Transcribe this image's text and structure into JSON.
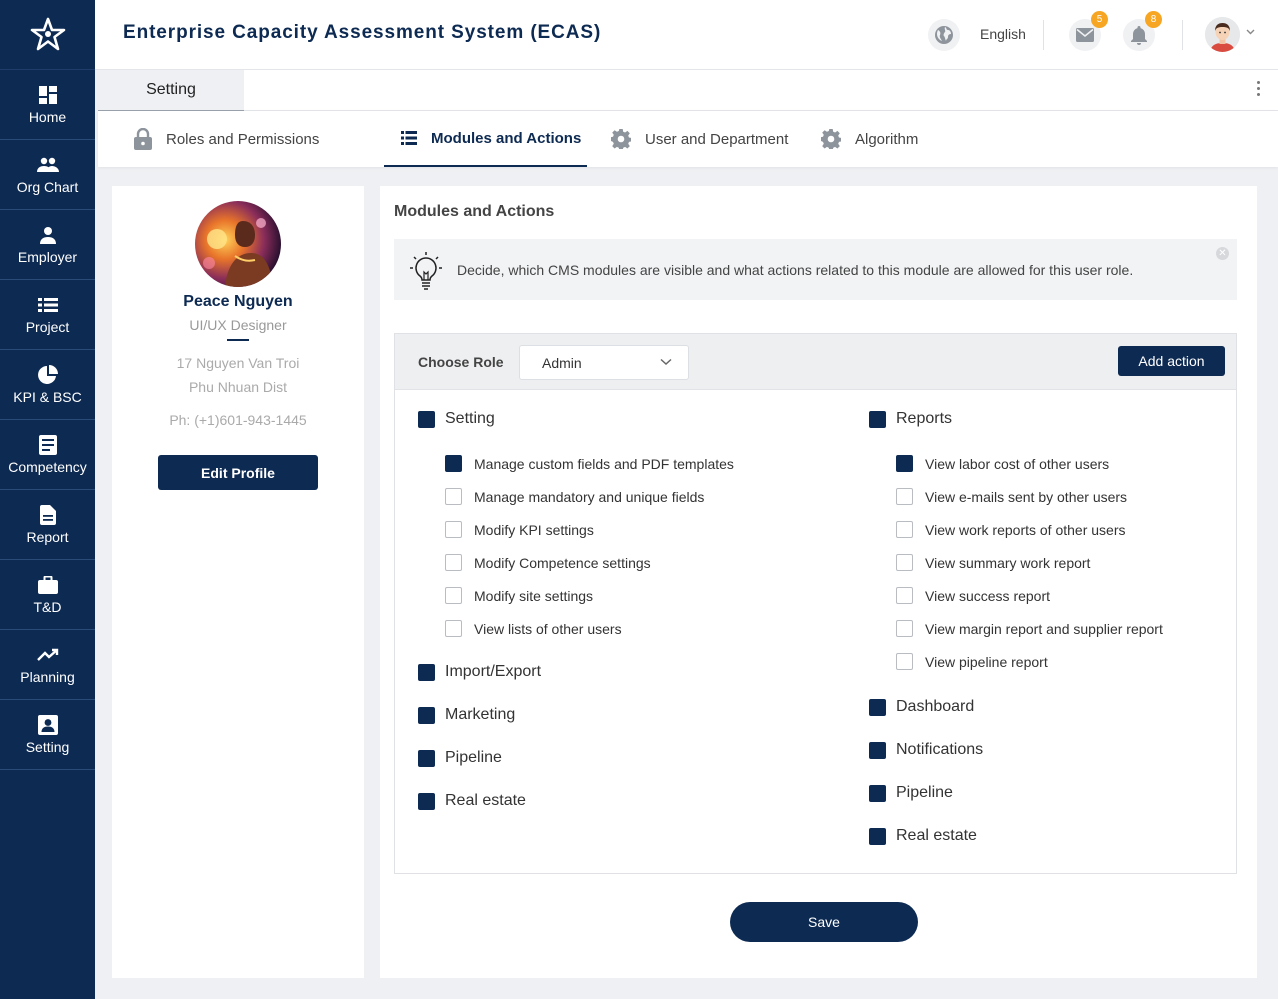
{
  "app": {
    "title": "Enterprise Capacity Assessment System (ECAS)"
  },
  "header": {
    "language": "English",
    "mail_count": "5",
    "notification_count": "8"
  },
  "sidebar": {
    "items": [
      {
        "label": "Home",
        "icon": "dashboard-icon"
      },
      {
        "label": "Org Chart",
        "icon": "people-icon"
      },
      {
        "label": "Employer",
        "icon": "person-icon"
      },
      {
        "label": "Project",
        "icon": "list-icon"
      },
      {
        "label": "KPI & BSC",
        "icon": "pie-chart-icon"
      },
      {
        "label": "Competency",
        "icon": "document-icon"
      },
      {
        "label": "Report",
        "icon": "file-icon"
      },
      {
        "label": "T&D",
        "icon": "briefcase-icon"
      },
      {
        "label": "Planning",
        "icon": "trending-up-icon"
      },
      {
        "label": "Setting",
        "icon": "badge-icon"
      }
    ]
  },
  "page_tab": "Setting",
  "tabs": [
    {
      "label": "Roles and Permissions",
      "icon": "lock-icon"
    },
    {
      "label": "Modules and Actions",
      "icon": "list-icon",
      "active": true
    },
    {
      "label": "User and Department",
      "icon": "gear-icon"
    },
    {
      "label": "Algorithm",
      "icon": "gear-icon"
    }
  ],
  "profile": {
    "name": "Peace Nguyen",
    "role": "UI/UX Designer",
    "address_line1": "17 Nguyen Van Troi",
    "address_line2": "Phu Nhuan Dist",
    "phone": "Ph: (+1)601-943-1445",
    "edit_label": "Edit Profile"
  },
  "main": {
    "title": "Modules and Actions",
    "info_text": "Decide, which CMS modules are visible and what actions related to this module are allowed for this user role.",
    "choose_role_label": "Choose Role",
    "role_value": "Admin",
    "add_action_label": "Add action",
    "save_label": "Save"
  },
  "modules": {
    "left": {
      "group": "Setting",
      "items": [
        {
          "label": "Manage custom fields and PDF templates",
          "checked": true
        },
        {
          "label": "Manage mandatory and unique fields",
          "checked": false
        },
        {
          "label": "Modify KPI settings",
          "checked": false
        },
        {
          "label": "Modify Competence settings",
          "checked": false
        },
        {
          "label": "Modify site settings",
          "checked": false
        },
        {
          "label": "View lists of other users",
          "checked": false
        }
      ],
      "others": [
        "Import/Export",
        "Marketing",
        "Pipeline",
        "Real estate"
      ]
    },
    "right": {
      "group": "Reports",
      "items": [
        {
          "label": "View labor cost of other users",
          "checked": true
        },
        {
          "label": "View e-mails sent by other users",
          "checked": false
        },
        {
          "label": "View work reports of other users",
          "checked": false
        },
        {
          "label": "View summary work report",
          "checked": false
        },
        {
          "label": "View success report",
          "checked": false
        },
        {
          "label": "View margin report and supplier report",
          "checked": false
        },
        {
          "label": "View pipeline report",
          "checked": false
        }
      ],
      "others": [
        "Dashboard",
        "Notifications",
        "Pipeline",
        "Real estate"
      ]
    }
  },
  "colors": {
    "primary": "#0d2a52",
    "badge": "#f6a623",
    "background": "#eef0f3"
  }
}
